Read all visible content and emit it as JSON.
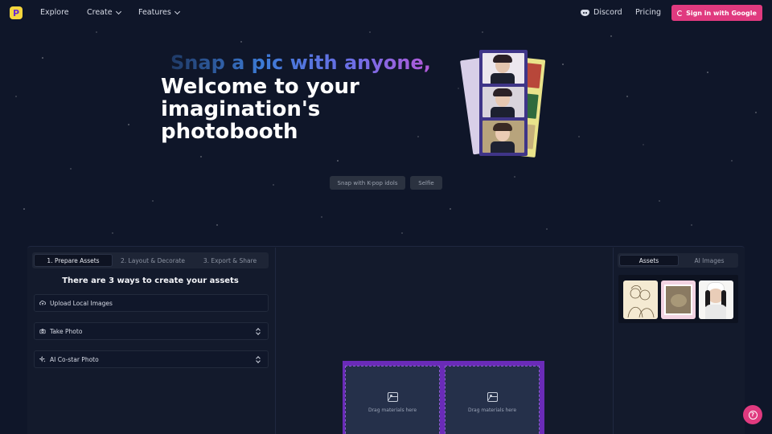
{
  "nav": {
    "logo_letter": "P",
    "links": [
      "Explore",
      "Create",
      "Features"
    ],
    "discord": "Discord",
    "pricing": "Pricing",
    "signin": "Sign in with Google"
  },
  "hero": {
    "subtitle": "Snap a pic with anyone,",
    "title": "Welcome to your imagination's photobooth",
    "buttons": [
      "Snap with K-pop idols",
      "Selfie"
    ]
  },
  "editor": {
    "steps": [
      "1. Prepare Assets",
      "2. Layout & Decorate",
      "3. Export & Share"
    ],
    "ways_title": "There are 3 ways to create your assets",
    "ways": [
      "Upload Local Images",
      "Take Photo",
      "AI Co-star Photo"
    ],
    "slot_text": "Drag materials here",
    "right_tabs": [
      "Assets",
      "AI Images"
    ]
  },
  "colors": {
    "accent": "#e03a7f",
    "canvas_border": "#6a2bb8",
    "background": "#0f1629"
  },
  "icons": {
    "help": "help-circle-icon"
  }
}
